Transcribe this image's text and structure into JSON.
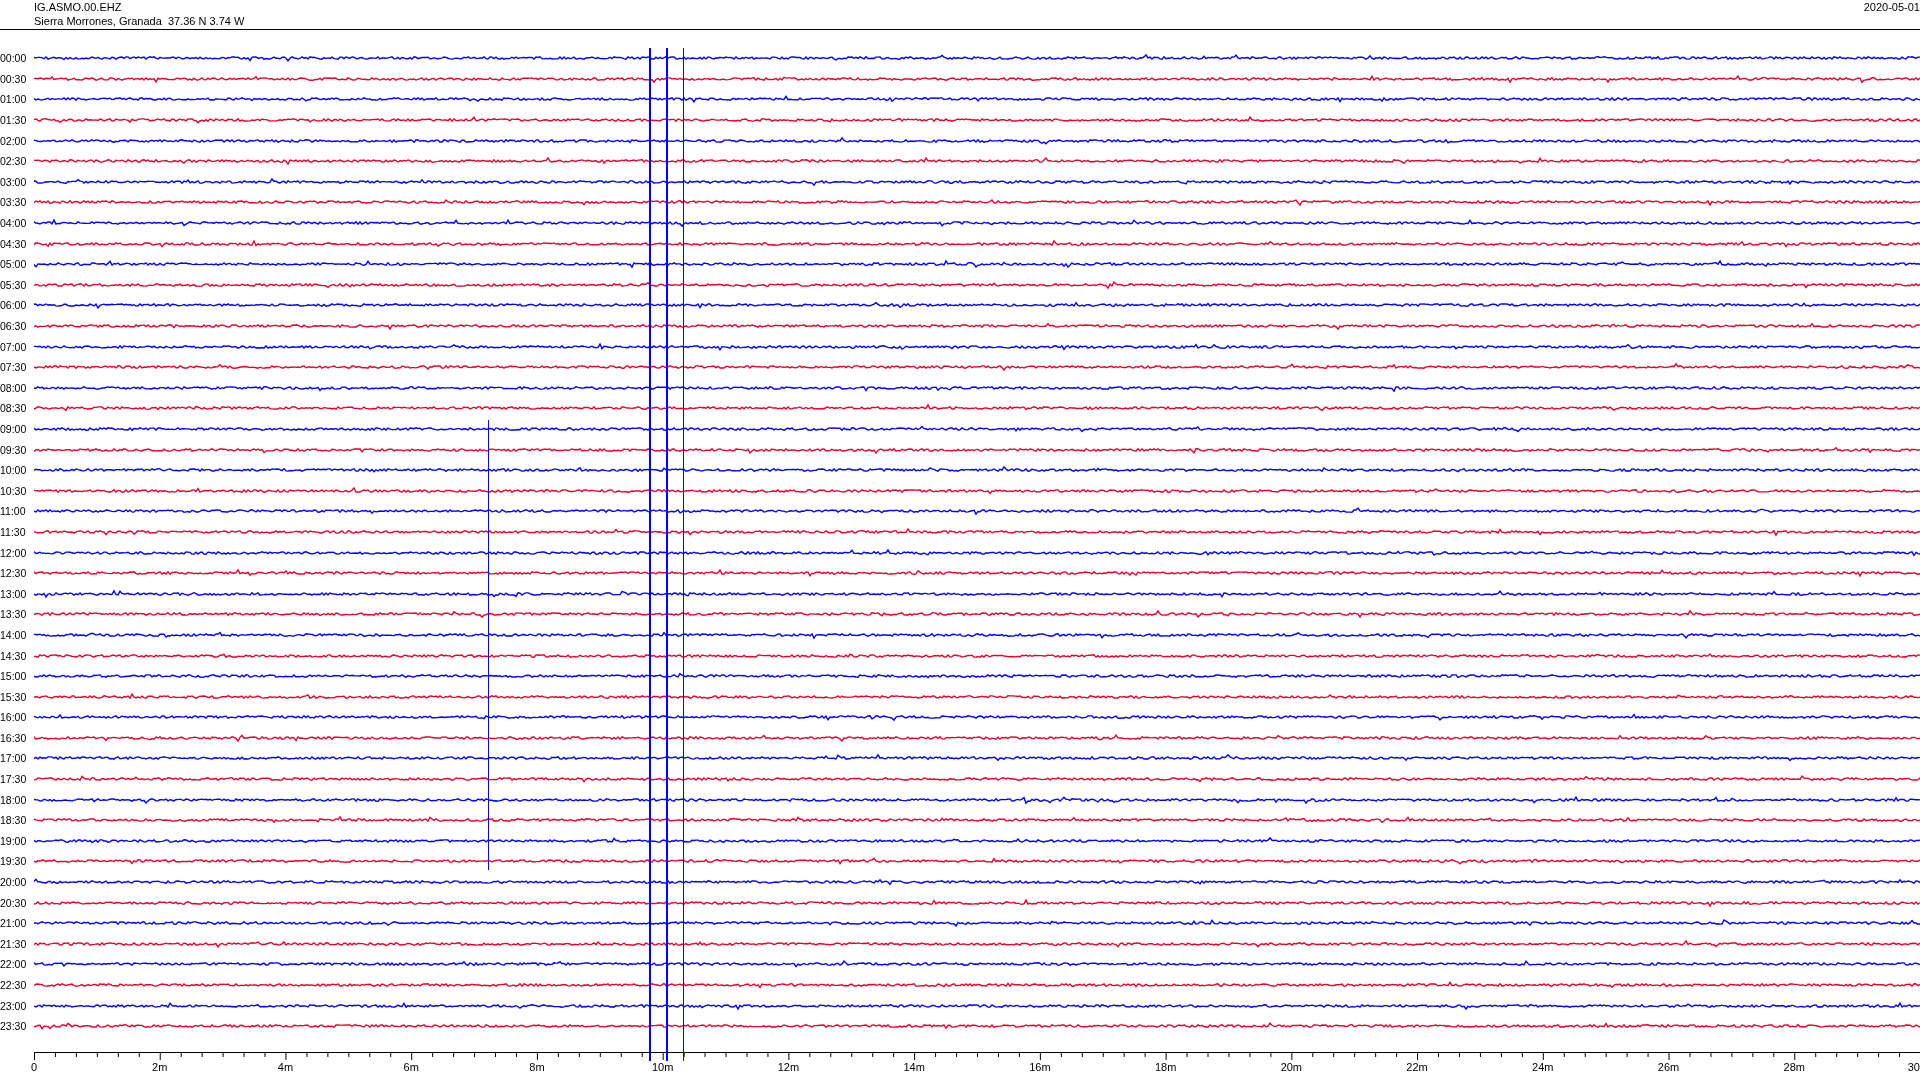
{
  "header": {
    "station": "IG.ASMO.00.EHZ",
    "location": "Sierra Morrones, Granada  37.36 N 3.74 W",
    "date": "2020-05-01"
  },
  "rows": [
    {
      "time": "00:00",
      "color": "#0000ff"
    },
    {
      "time": "00:30",
      "color": "#e6002e"
    },
    {
      "time": "01:00",
      "color": "#0000ff"
    },
    {
      "time": "01:30",
      "color": "#e6002e"
    },
    {
      "time": "02:00",
      "color": "#0000ff"
    },
    {
      "time": "02:30",
      "color": "#e6002e"
    },
    {
      "time": "03:00",
      "color": "#0000ff"
    },
    {
      "time": "03:30",
      "color": "#e6002e"
    },
    {
      "time": "04:00",
      "color": "#0000ff"
    },
    {
      "time": "04:30",
      "color": "#e6002e"
    },
    {
      "time": "05:00",
      "color": "#0000ff"
    },
    {
      "time": "05:30",
      "color": "#e6002e"
    },
    {
      "time": "06:00",
      "color": "#0000ff"
    },
    {
      "time": "06:30",
      "color": "#e6002e"
    },
    {
      "time": "07:00",
      "color": "#0000ff"
    },
    {
      "time": "07:30",
      "color": "#e6002e"
    },
    {
      "time": "08:00",
      "color": "#0000ff"
    },
    {
      "time": "08:30",
      "color": "#e6002e"
    },
    {
      "time": "09:00",
      "color": "#0000ff"
    },
    {
      "time": "09:30",
      "color": "#e6002e"
    },
    {
      "time": "10:00",
      "color": "#0000ff"
    },
    {
      "time": "10:30",
      "color": "#e6002e"
    },
    {
      "time": "11:00",
      "color": "#0000ff"
    },
    {
      "time": "11:30",
      "color": "#e6002e"
    },
    {
      "time": "12:00",
      "color": "#0000ff"
    },
    {
      "time": "12:30",
      "color": "#e6002e"
    },
    {
      "time": "13:00",
      "color": "#0000ff"
    },
    {
      "time": "13:30",
      "color": "#e6002e"
    },
    {
      "time": "14:00",
      "color": "#0000ff"
    },
    {
      "time": "14:30",
      "color": "#e6002e"
    },
    {
      "time": "15:00",
      "color": "#0000ff"
    },
    {
      "time": "15:30",
      "color": "#e6002e"
    },
    {
      "time": "16:00",
      "color": "#0000ff"
    },
    {
      "time": "16:30",
      "color": "#e6002e"
    },
    {
      "time": "17:00",
      "color": "#0000ff"
    },
    {
      "time": "17:30",
      "color": "#e6002e"
    },
    {
      "time": "18:00",
      "color": "#0000ff"
    },
    {
      "time": "18:30",
      "color": "#e6002e"
    },
    {
      "time": "19:00",
      "color": "#0000ff"
    },
    {
      "time": "19:30",
      "color": "#e6002e"
    },
    {
      "time": "20:00",
      "color": "#0000ff"
    },
    {
      "time": "20:30",
      "color": "#e6002e"
    },
    {
      "time": "21:00",
      "color": "#0000ff"
    },
    {
      "time": "21:30",
      "color": "#e6002e"
    },
    {
      "time": "22:00",
      "color": "#0000ff"
    },
    {
      "time": "22:30",
      "color": "#e6002e"
    },
    {
      "time": "23:00",
      "color": "#0000ff"
    },
    {
      "time": "23:30",
      "color": "#e6002e"
    }
  ],
  "x_axis": {
    "ticks": [
      "0",
      "2m",
      "4m",
      "6m",
      "8m",
      "10m",
      "12m",
      "14m",
      "16m",
      "18m",
      "20m",
      "22m",
      "24m",
      "26m",
      "28m",
      "30"
    ]
  }
}
